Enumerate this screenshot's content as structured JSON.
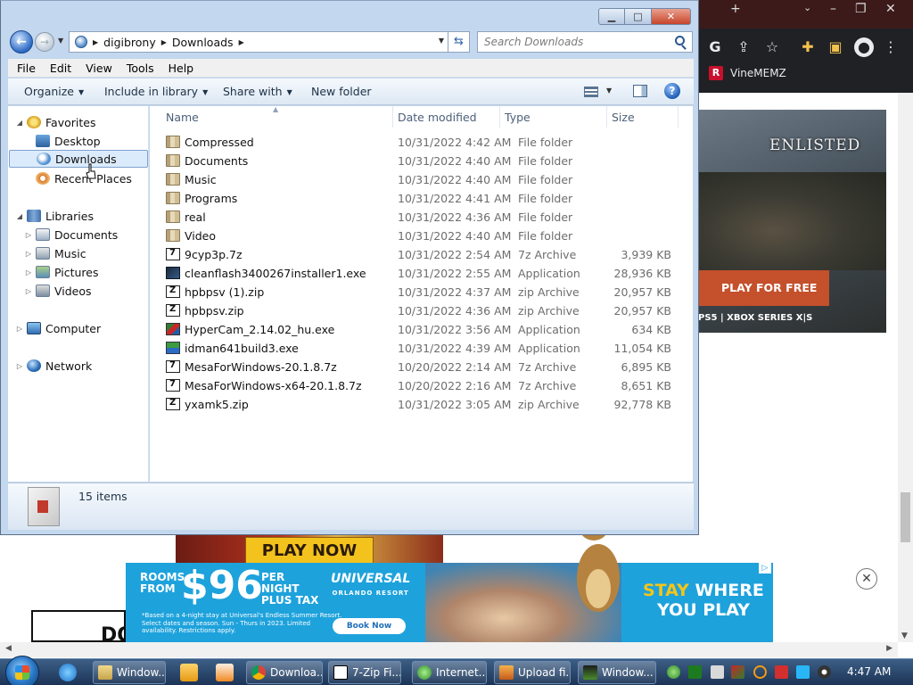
{
  "browser": {
    "bookmark": "VineMEMZ",
    "enlisted_logo": "ENLISTED",
    "enlisted_cta": "PLAY FOR FREE",
    "enlisted_platforms": "PS5 | XBOX SERIES X|S",
    "play_now": "PLAY NOW",
    "partial_ad_text": "DO",
    "universal_ad": {
      "rooms_from": "ROOMS FROM",
      "price": "$96",
      "per_night": "PER NIGHT PLUS TAX",
      "fine_print": "*Based on a 4-night stay at Universal's Endless Summer Resort. Select dates and season. Sun - Thurs in 2023. Limited availability. Restrictions apply.",
      "logo": "UNIVERSAL",
      "logo_sub": "ORLANDO RESORT",
      "book_now": "Book Now",
      "tagline_1": "STAY",
      "tagline_2": "WHERE",
      "tagline_3": "YOU PLAY"
    }
  },
  "window": {
    "address": {
      "crumbs": [
        "digibrony",
        "Downloads"
      ]
    },
    "search_placeholder": "Search Downloads",
    "menu": [
      "File",
      "Edit",
      "View",
      "Tools",
      "Help"
    ],
    "commands": {
      "organize": "Organize",
      "include": "Include in library",
      "share": "Share with",
      "new_folder": "New folder"
    },
    "nav": {
      "favorites": "Favorites",
      "desktop": "Desktop",
      "downloads": "Downloads",
      "recent": "Recent Places",
      "libraries": "Libraries",
      "documents": "Documents",
      "music": "Music",
      "pictures": "Pictures",
      "videos": "Videos",
      "computer": "Computer",
      "network": "Network"
    },
    "columns": {
      "name": "Name",
      "date": "Date modified",
      "type": "Type",
      "size": "Size"
    },
    "files": [
      {
        "name": "Compressed",
        "date": "10/31/2022 4:42 AM",
        "type": "File folder",
        "size": "",
        "icon": "folder-icon"
      },
      {
        "name": "Documents",
        "date": "10/31/2022 4:40 AM",
        "type": "File folder",
        "size": "",
        "icon": "folder-icon"
      },
      {
        "name": "Music",
        "date": "10/31/2022 4:40 AM",
        "type": "File folder",
        "size": "",
        "icon": "folder-icon"
      },
      {
        "name": "Programs",
        "date": "10/31/2022 4:41 AM",
        "type": "File folder",
        "size": "",
        "icon": "folder-icon"
      },
      {
        "name": "real",
        "date": "10/31/2022 4:36 AM",
        "type": "File folder",
        "size": "",
        "icon": "folder-icon"
      },
      {
        "name": "Video",
        "date": "10/31/2022 4:40 AM",
        "type": "File folder",
        "size": "",
        "icon": "folder-icon"
      },
      {
        "name": "9cyp3p.7z",
        "date": "10/31/2022 2:54 AM",
        "type": "7z Archive",
        "size": "3,939 KB",
        "icon": "7z-archive-icon"
      },
      {
        "name": "cleanflash3400267installer1.exe",
        "date": "10/31/2022 2:55 AM",
        "type": "Application",
        "size": "28,936 KB",
        "icon": "flash-installer-icon"
      },
      {
        "name": "hpbpsv (1).zip",
        "date": "10/31/2022 4:37 AM",
        "type": "zip Archive",
        "size": "20,957 KB",
        "icon": "zip-archive-icon"
      },
      {
        "name": "hpbpsv.zip",
        "date": "10/31/2022 4:36 AM",
        "type": "zip Archive",
        "size": "20,957 KB",
        "icon": "zip-archive-icon"
      },
      {
        "name": "HyperCam_2.14.02_hu.exe",
        "date": "10/31/2022 3:56 AM",
        "type": "Application",
        "size": "634 KB",
        "icon": "hypercam-icon"
      },
      {
        "name": "idman641build3.exe",
        "date": "10/31/2022 4:39 AM",
        "type": "Application",
        "size": "11,054 KB",
        "icon": "idm-icon"
      },
      {
        "name": "MesaForWindows-20.1.8.7z",
        "date": "10/20/2022 2:14 AM",
        "type": "7z Archive",
        "size": "6,895 KB",
        "icon": "7z-archive-icon"
      },
      {
        "name": "MesaForWindows-x64-20.1.8.7z",
        "date": "10/20/2022 2:16 AM",
        "type": "7z Archive",
        "size": "8,651 KB",
        "icon": "7z-archive-icon"
      },
      {
        "name": "yxamk5.zip",
        "date": "10/31/2022 3:05 AM",
        "type": "zip Archive",
        "size": "92,778 KB",
        "icon": "zip-archive-icon"
      }
    ],
    "status": "15 items"
  },
  "taskbar": {
    "buttons": [
      "Window...",
      "Downloa...",
      "7-Zip Fi...",
      "Internet...",
      "Upload fi...",
      "Window..."
    ],
    "clock": "4:47 AM"
  }
}
